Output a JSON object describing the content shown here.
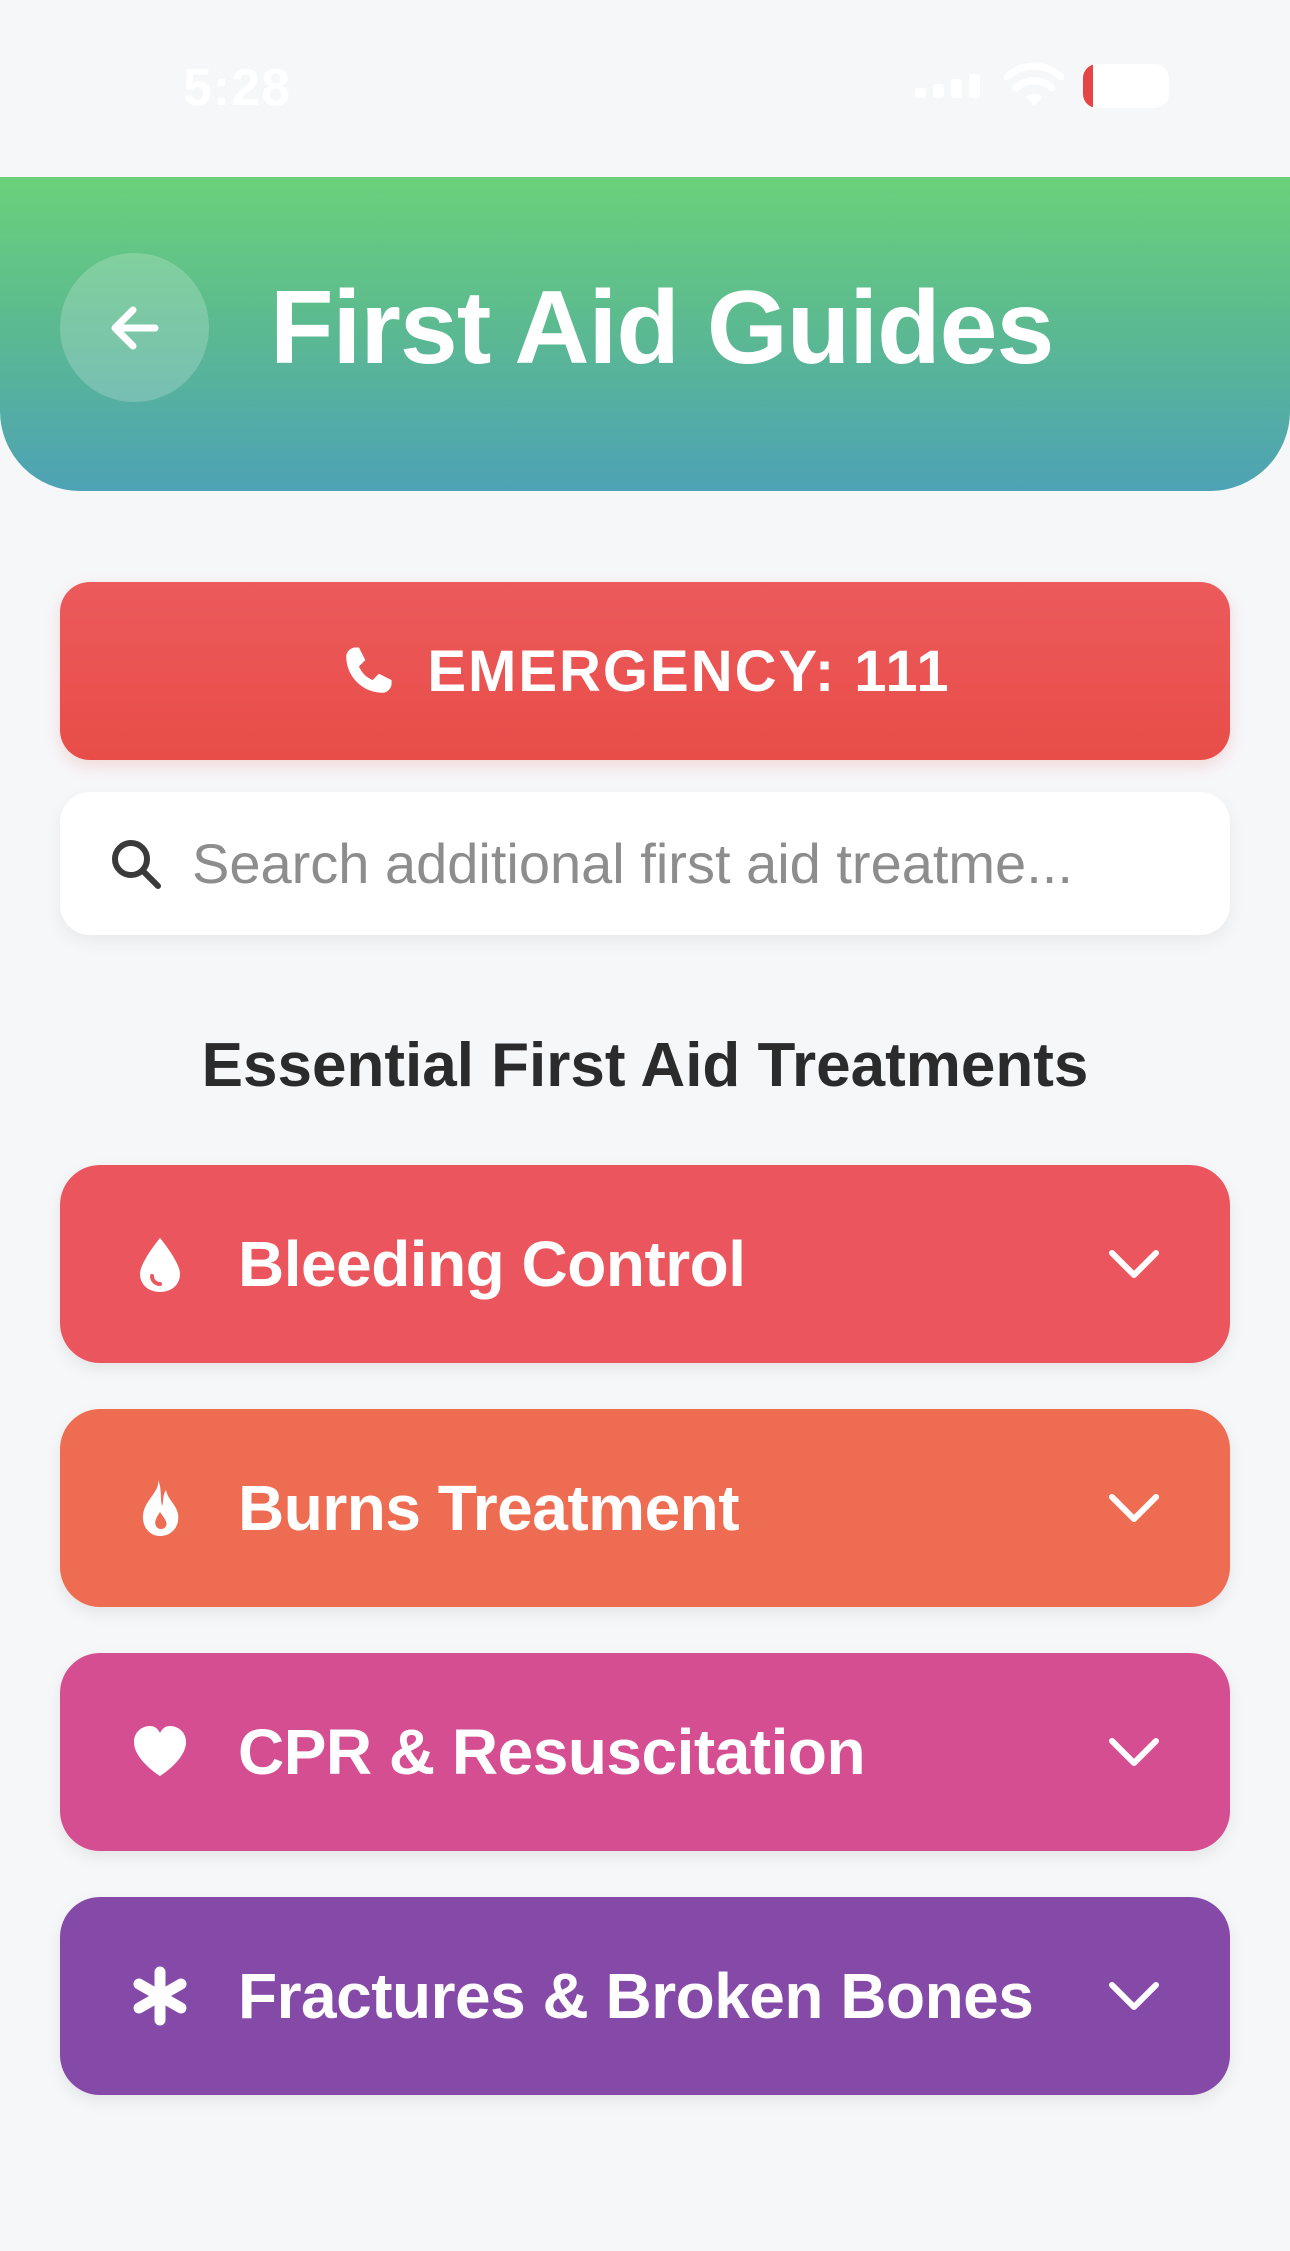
{
  "status_bar": {
    "time": "5:28",
    "battery": "9",
    "battery_level": 0.09
  },
  "header": {
    "title": "First Aid Guides",
    "back_icon": "arrow-left-icon",
    "gradient_colors": [
      "#6bd17a",
      "#4ea2b5"
    ]
  },
  "emergency": {
    "label": "EMERGENCY: 111",
    "icon": "phone-icon",
    "color": "#ea5350"
  },
  "search": {
    "placeholder": "Search additional first aid treatme...",
    "value": "",
    "icon": "search-icon"
  },
  "section": {
    "title": "Essential First Aid Treatments"
  },
  "treatments": [
    {
      "label": "Bleeding Control",
      "icon": "droplet-icon",
      "color": "#eb565e"
    },
    {
      "label": "Burns Treatment",
      "icon": "fire-icon",
      "color": "#ee6d52"
    },
    {
      "label": "CPR & Resuscitation",
      "icon": "heart-icon",
      "color": "#d64e92"
    },
    {
      "label": "Fractures & Broken Bones",
      "icon": "asterisk-icon",
      "color": "#8549a8"
    }
  ]
}
